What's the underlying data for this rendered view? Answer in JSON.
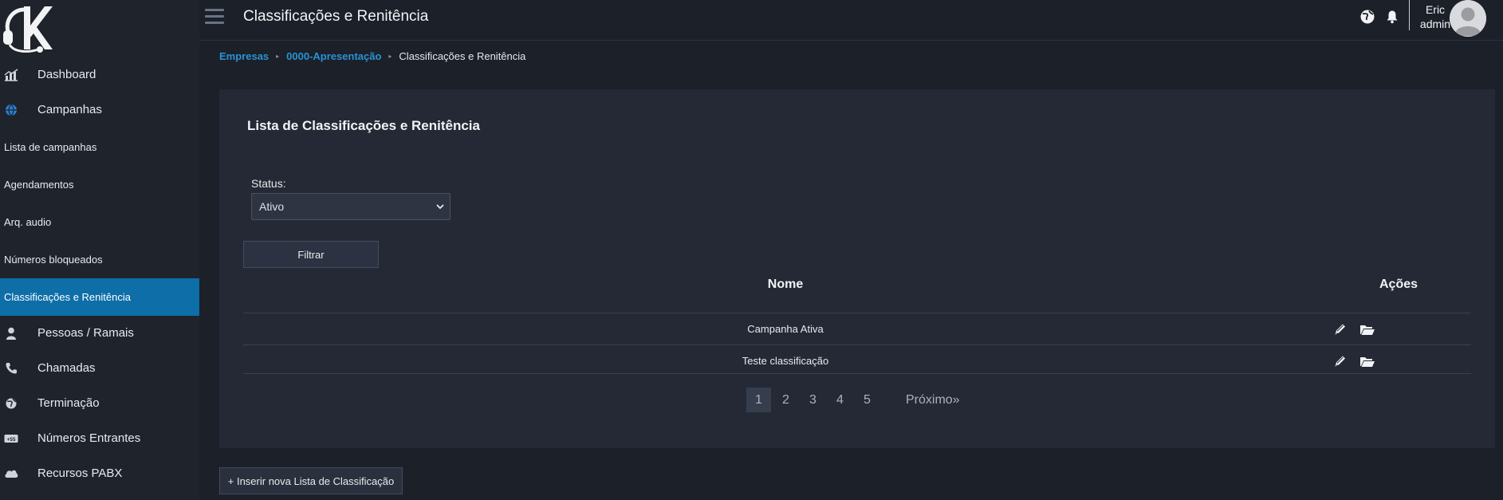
{
  "sidebar": {
    "logo_icon": "headset-k-logo",
    "items": [
      {
        "label": "Dashboard",
        "icon": "chart-icon"
      },
      {
        "label": "Campanhas",
        "icon": "globe-icon"
      },
      {
        "label": "Lista de campanhas"
      },
      {
        "label": "Agendamentos"
      },
      {
        "label": "Arq. audio"
      },
      {
        "label": "Números bloqueados"
      },
      {
        "label": "Classificações e Renitência",
        "active": true
      },
      {
        "label": "Pessoas / Ramais",
        "icon": "user-icon"
      },
      {
        "label": "Chamadas",
        "icon": "phone-icon"
      },
      {
        "label": "Terminação",
        "icon": "globe-arrows-icon"
      },
      {
        "label": "Números Entrantes",
        "icon": "number-badge-icon"
      },
      {
        "label": "Recursos PABX",
        "icon": "cloud-icon"
      }
    ]
  },
  "header": {
    "title": "Classificações e Renitência",
    "user_name": "Eric",
    "user_role": "admin"
  },
  "breadcrumb": {
    "items": [
      "Empresas",
      "0000-Apresentação"
    ],
    "current": "Classificações e Renitência"
  },
  "panel": {
    "title": "Lista de Classificações e Renitência",
    "status_label": "Status:",
    "status_value": "Ativo",
    "filter_label": "Filtrar"
  },
  "table": {
    "columns": [
      "Nome",
      "Ações"
    ],
    "rows": [
      {
        "name": "Campanha Ativa"
      },
      {
        "name": "Teste classificação"
      }
    ]
  },
  "pagination": {
    "pages": [
      "1",
      "2",
      "3",
      "4",
      "5"
    ],
    "current": "1",
    "next_label": "Próximo»"
  },
  "insert_button": "+ Inserir nova Lista de Classificação",
  "colors": {
    "accent": "#0d6ea8",
    "link": "#2a92d3",
    "background": "#1c2029",
    "panel": "#242935"
  }
}
